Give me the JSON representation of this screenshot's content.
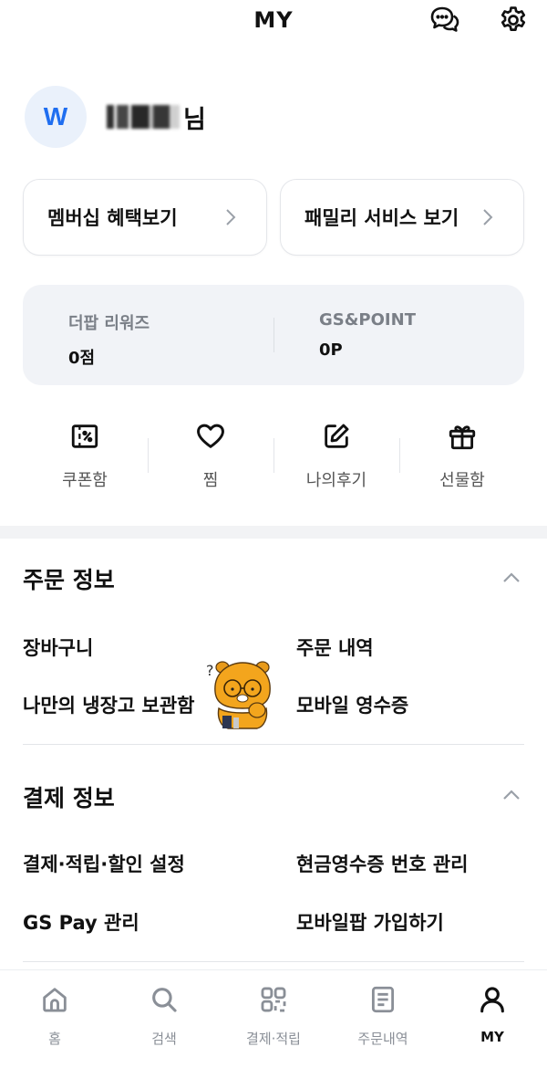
{
  "header": {
    "title": "MY",
    "icons": [
      "chat-bubble-icon",
      "gear-icon"
    ]
  },
  "profile": {
    "avatar_letter": "W",
    "name_suffix": "님"
  },
  "cards": {
    "membership": "멤버십 혜택보기",
    "family": "패밀리 서비스 보기"
  },
  "points": {
    "thepop": {
      "label": "더팝 리워즈",
      "value": "0점"
    },
    "gspoint": {
      "label": "GS&POINT",
      "value": "0P"
    }
  },
  "quick": [
    {
      "label": "쿠폰함",
      "icon": "coupon-icon"
    },
    {
      "label": "찜",
      "icon": "heart-icon"
    },
    {
      "label": "나의후기",
      "icon": "pencil-icon"
    },
    {
      "label": "선물함",
      "icon": "gift-icon"
    }
  ],
  "order_info": {
    "title": "주문 정보",
    "items": [
      "장바구니",
      "주문 내역",
      "나만의 냉장고 보관함",
      "모바일 영수증"
    ]
  },
  "payment_info": {
    "title": "결제 정보",
    "items": [
      "결제·적립·할인 설정",
      "현금영수증 번호 관리",
      "GS Pay 관리",
      "모바일팝 가입하기"
    ]
  },
  "bottom_nav": [
    {
      "label": "홈",
      "icon": "home-icon"
    },
    {
      "label": "검색",
      "icon": "search-icon"
    },
    {
      "label": "결제·적립",
      "icon": "qr-code-icon"
    },
    {
      "label": "주문내역",
      "icon": "document-icon"
    },
    {
      "label": "MY",
      "icon": "person-icon",
      "active": true
    }
  ],
  "colors": {
    "accent": "#1f6ef0",
    "panel": "#f1f3f7",
    "muted": "#7a7f87",
    "mascot": "#f3a51d"
  }
}
